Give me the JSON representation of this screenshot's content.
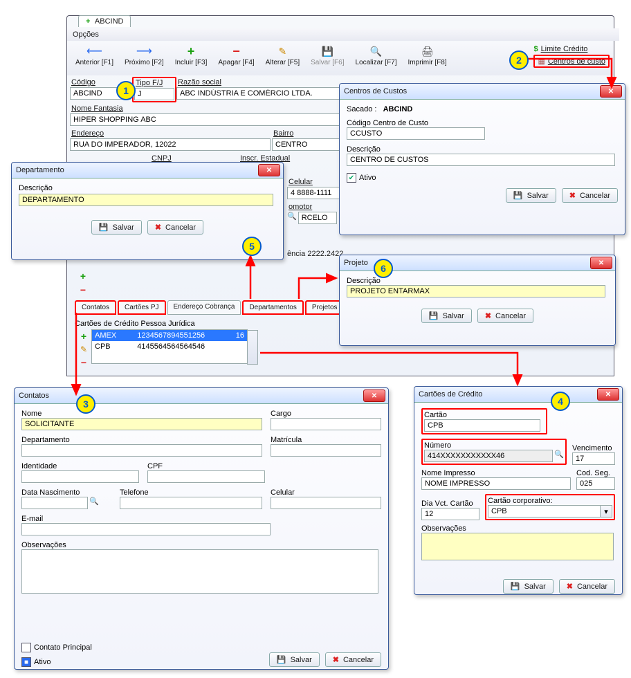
{
  "main": {
    "tab_plus": "+",
    "tab_label": "ABCIND",
    "menu_opcoes": "Opções",
    "toolbar": {
      "anterior": "Anterior [F1]",
      "proximo": "Próximo [F2]",
      "incluir": "Incluir [F3]",
      "apagar": "Apagar [F4]",
      "alterar": "Alterar [F5]",
      "salvar": "Salvar [F6]",
      "localizar": "Localizar [F7]",
      "imprimir": "Imprimir [F8]",
      "limite_credito": "Limite Crédito",
      "centros_custo": "Centros de custo"
    },
    "labels": {
      "codigo": "Código",
      "tipo": "Tipo F/J",
      "razao": "Razão social",
      "nome_fantasia": "Nome Fantasia",
      "endereco": "Endereço",
      "bairro": "Bairro",
      "cnpj": "CNPJ",
      "insc_estadual": "Inscr. Estadual",
      "celular": "Celular",
      "promotor": "omotor"
    },
    "values": {
      "codigo": "ABCIND",
      "tipo": "J",
      "razao": "ABC INDÚSTRIA E COMÉRCIO LTDA.",
      "nome_fantasia": "HIPER SHOPPING ABC",
      "endereco": "RUA DO IMPERADOR, 12022",
      "bairro": "CENTRO",
      "celular": "4 8888-1111",
      "promotor": "RCELO",
      "ref_line": "ência 2222.2422"
    }
  },
  "badges": {
    "b1": "1",
    "b2": "2",
    "b3": "3",
    "b4": "4",
    "b5": "5",
    "b6": "6"
  },
  "dept": {
    "title": "Departamento",
    "descricao_lbl": "Descrição",
    "descricao_val": "DEPARTAMENTO",
    "salvar": "Salvar",
    "cancelar": "Cancelar"
  },
  "centros": {
    "title": "Centros de Custos",
    "sacado_lbl": "Sacado :",
    "sacado_val": "ABCIND",
    "codigo_lbl": "Código Centro de Custo",
    "codigo_val": "CCUSTO",
    "descricao_lbl": "Descrição",
    "descricao_val": "CENTRO DE CUSTOS",
    "ativo": "Ativo",
    "salvar": "Salvar",
    "cancelar": "Cancelar"
  },
  "projeto": {
    "title": "Projeto",
    "descricao_lbl": "Descrição",
    "descricao_val": "PROJETO ENTARMAX",
    "salvar": "Salvar",
    "cancelar": "Cancelar"
  },
  "tabs": {
    "contatos": "Contatos",
    "cartoes_pj": "Cartões PJ",
    "endereco_cobranca": "Endereço Cobrança",
    "departamentos": "Departamentos",
    "projetos": "Projetos"
  },
  "cards_panel": {
    "title": "Cartões de Crédito Pessoa Jurídica",
    "rows": [
      {
        "brand": "AMEX",
        "number": "1234567894551256",
        "ext": "16"
      },
      {
        "brand": "CPB",
        "number": "4145564564564546",
        "ext": ""
      }
    ]
  },
  "contatos": {
    "title": "Contatos",
    "nome_lbl": "Nome",
    "nome_val": "SOLICITANTE",
    "cargo_lbl": "Cargo",
    "departamento_lbl": "Departamento",
    "matricula_lbl": "Matrícula",
    "identidade_lbl": "Identidade",
    "cpf_lbl": "CPF",
    "data_nasc_lbl": "Data Nascimento",
    "telefone_lbl": "Telefone",
    "celular_lbl": "Celular",
    "email_lbl": "E-mail",
    "obs_lbl": "Observações",
    "contato_principal": "Contato Principal",
    "ativo": "Ativo",
    "salvar": "Salvar",
    "cancelar": "Cancelar"
  },
  "cartoes": {
    "title": "Cartões de Crédito",
    "cartao_lbl": "Cartão",
    "cartao_val": "CPB",
    "numero_lbl": "Número",
    "numero_val": "414XXXXXXXXXXX46",
    "venc_lbl": "Vencimento",
    "venc_val": "17",
    "nome_imp_lbl": "Nome Impresso",
    "nome_imp_val": "NOME IMPRESSO",
    "cod_seg_lbl": "Cod. Seg.",
    "cod_seg_val": "025",
    "dia_vct_lbl": "Dia Vct. Cartão",
    "dia_vct_val": "12",
    "corporativo_lbl": "Cartão corporativo:",
    "corporativo_val": "CPB",
    "obs_lbl": "Observações",
    "salvar": "Salvar",
    "cancelar": "Cancelar"
  }
}
